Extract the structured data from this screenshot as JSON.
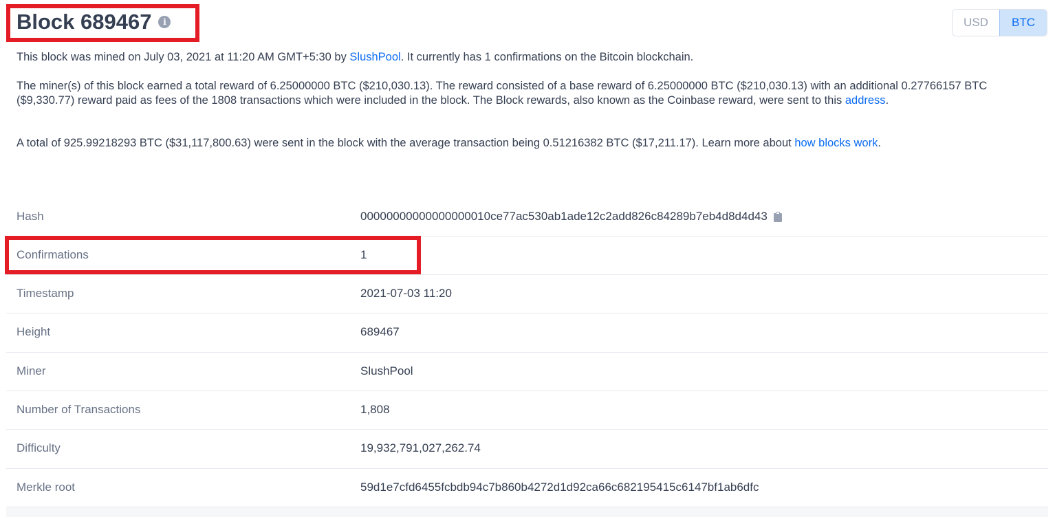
{
  "header": {
    "title": "Block 689467",
    "currency_usd": "USD",
    "currency_btc": "BTC"
  },
  "description": {
    "p1_pre": "This block was mined on July 03, 2021 at 11:20 AM GMT+5:30 by ",
    "p1_link": "SlushPool",
    "p1_post": ". It currently has 1 confirmations on the Bitcoin blockchain.",
    "p2_pre": "The miner(s) of this block earned a total reward of 6.25000000 BTC ($210,030.13). The reward consisted of a base reward of 6.25000000 BTC ($210,030.13) with an additional 0.27766157 BTC ($9,330.77) reward paid as fees of the 1808 transactions which were included in the block. The Block rewards, also known as the Coinbase reward, were sent to this ",
    "p2_link": "address",
    "p2_post": ".",
    "p3_pre": "A total of 925.99218293 BTC ($31,117,800.63) were sent in the block with the average transaction being 0.51216382 BTC ($17,211.17).  Learn more about ",
    "p3_link": "how blocks work",
    "p3_post": "."
  },
  "details": {
    "hash_label": "Hash",
    "hash_value": "00000000000000000010ce77ac530ab1ade12c2add826c84289b7eb4d8d4d43",
    "confirmations_label": "Confirmations",
    "confirmations_value": "1",
    "timestamp_label": "Timestamp",
    "timestamp_value": "2021-07-03 11:20",
    "height_label": "Height",
    "height_value": "689467",
    "miner_label": "Miner",
    "miner_value": "SlushPool",
    "num_tx_label": "Number of Transactions",
    "num_tx_value": "1,808",
    "difficulty_label": "Difficulty",
    "difficulty_value": "19,932,791,027,262.74",
    "merkle_label": "Merkle root",
    "merkle_value": "59d1e7cfd6455fcbdb94c7b860b4272d1d92ca66c682195415c6147bf1ab6dfc"
  },
  "colors": {
    "highlight": "#e31c25",
    "link": "#0c6cf2",
    "active_toggle_bg": "#cfe3fb"
  },
  "icons": {
    "info": "info-icon",
    "clipboard": "clipboard-icon"
  }
}
